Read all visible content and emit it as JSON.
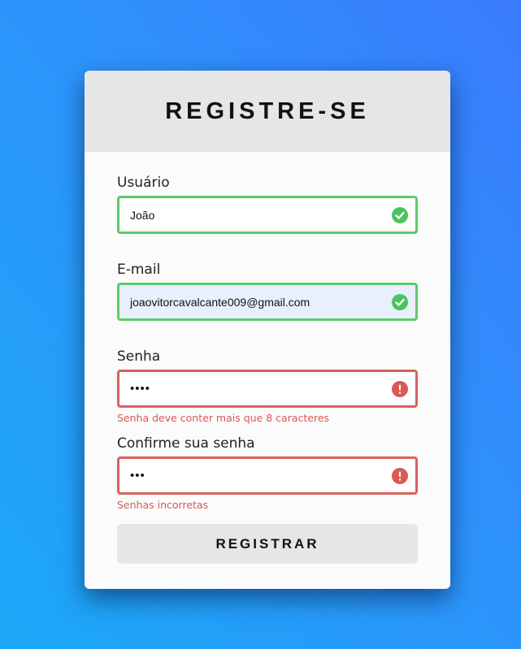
{
  "form": {
    "title": "REGISTRE-SE",
    "fields": [
      {
        "label": "Usuário",
        "value": "João",
        "type": "text",
        "status": "valid",
        "status_icon": "check-circle-icon"
      },
      {
        "label": "E-mail",
        "value": "joaovitorcavalcante009@gmail.com",
        "type": "email",
        "status": "valid",
        "status_icon": "check-circle-icon"
      },
      {
        "label": "Senha",
        "value": "1234",
        "type": "password",
        "status": "error",
        "status_icon": "exclamation-circle-icon",
        "error": "Senha deve conter mais que 8 caracteres"
      },
      {
        "label": "Confirme sua senha",
        "value": "123",
        "type": "password",
        "status": "error",
        "status_icon": "exclamation-circle-icon",
        "error": "Senhas incorretas"
      }
    ],
    "submit_label": "REGISTRAR"
  },
  "colors": {
    "valid": "#5ccb6a",
    "error": "#d9625f",
    "header_bg": "#e6e6e6",
    "button_bg": "#e6e6e6"
  }
}
